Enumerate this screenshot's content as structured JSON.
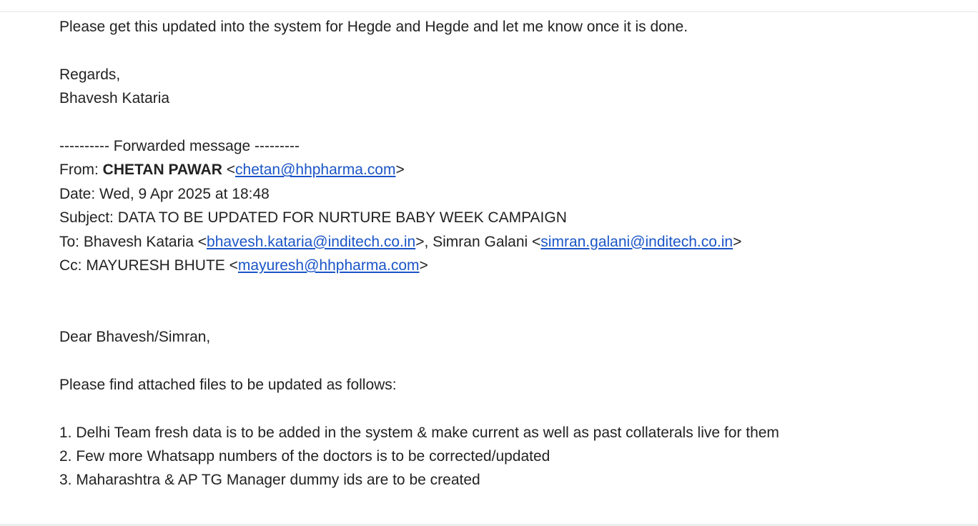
{
  "intro": "Please get this updated into the system for Hegde and Hegde and let me know once it is done.",
  "regards": "Regards,",
  "sender_name": "Bhavesh Kataria",
  "forwarded_header": "---------- Forwarded message ---------",
  "from": {
    "label": "From: ",
    "name": "CHETAN PAWAR",
    "open": " <",
    "email": "chetan@hhpharma.com",
    "close": ">"
  },
  "date": "Date: Wed, 9 Apr 2025 at 18:48",
  "subject": "Subject: DATA TO BE UPDATED FOR NURTURE BABY WEEK CAMPAIGN",
  "to": {
    "label": "To: Bhavesh Kataria <",
    "email1": "bhavesh.kataria@inditech.co.in",
    "mid": ">, Simran Galani <",
    "email2": "simran.galani@inditech.co.in",
    "close": ">"
  },
  "cc": {
    "label": "Cc: MAYURESH BHUTE <",
    "email": "mayuresh@hhpharma.com",
    "close": ">"
  },
  "greeting": "Dear Bhavesh/Simran,",
  "attached_intro": "Please find attached files to be updated as follows:",
  "items": [
    "1. Delhi Team fresh data is to be added in the system & make current as well as past collaterals live for them",
    "2. Few more Whatsapp numbers of the doctors is to be corrected/updated",
    "3. Maharashtra & AP TG Manager dummy ids are to be created"
  ]
}
